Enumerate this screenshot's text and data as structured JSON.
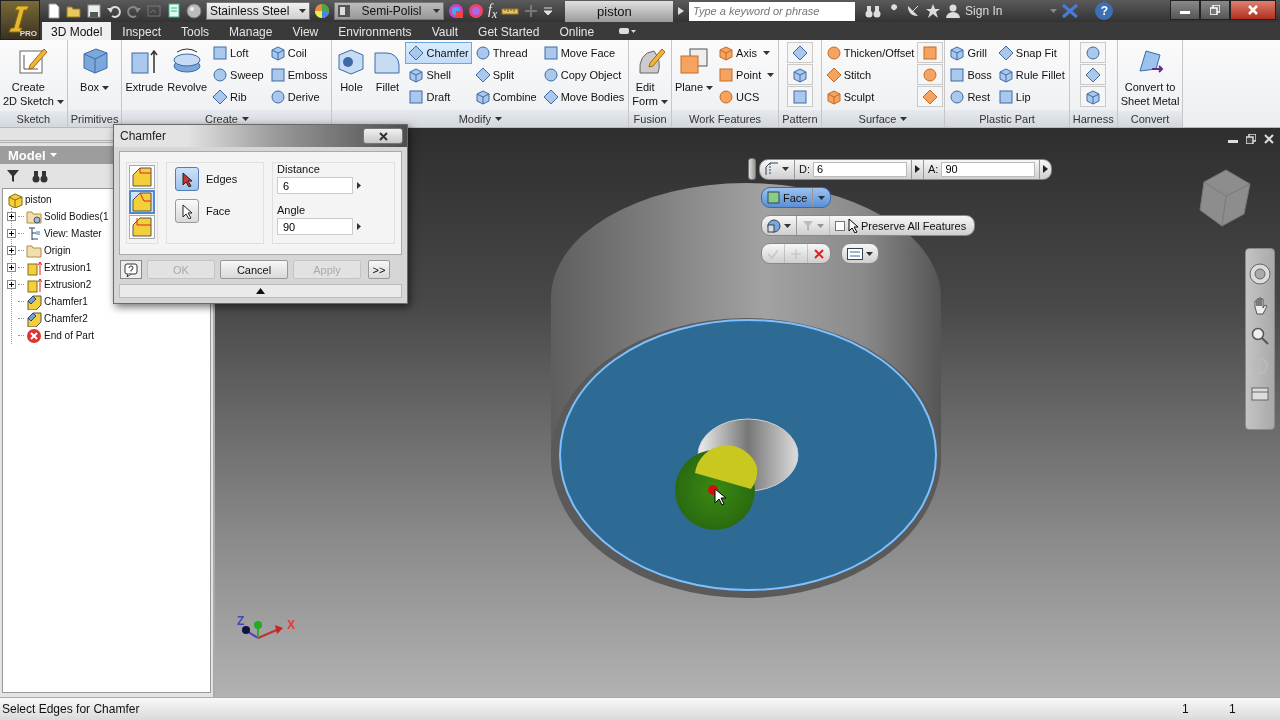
{
  "app": {
    "edition_badge": "PRO"
  },
  "quick_access": {
    "material": "Stainless Steel",
    "appearance": "Semi-Polisl",
    "parameters": "f$_{x}$"
  },
  "document_tab": {
    "title": "piston"
  },
  "search": {
    "placeholder": "Type a keyword or phrase"
  },
  "account": {
    "sign_in": "Sign In",
    "help": "?"
  },
  "tabs": [
    {
      "label": "3D Model",
      "selected": true
    },
    {
      "label": "Inspect",
      "selected": false
    },
    {
      "label": "Tools",
      "selected": false
    },
    {
      "label": "Manage",
      "selected": false
    },
    {
      "label": "View",
      "selected": false
    },
    {
      "label": "Environments",
      "selected": false
    },
    {
      "label": "Vault",
      "selected": false
    },
    {
      "label": "Get Started",
      "selected": false
    },
    {
      "label": "Online",
      "selected": false
    }
  ],
  "ribbon": {
    "panels": [
      {
        "title": "Sketch",
        "has_menu": false,
        "tools": [
          {
            "kind": "large",
            "label": "Create\n2D Sketch",
            "has_menu": true,
            "selected": false
          }
        ]
      },
      {
        "title": "Primitives",
        "has_menu": false,
        "tools": [
          {
            "kind": "large",
            "label": "Box",
            "has_menu": true,
            "selected": false
          }
        ]
      },
      {
        "title": "Create",
        "has_menu": true,
        "tools": [
          {
            "kind": "large",
            "label": "Extrude",
            "has_menu": false,
            "selected": false
          },
          {
            "kind": "large",
            "label": "Revolve",
            "has_menu": false,
            "selected": false
          },
          {
            "kind": "small",
            "label": "Loft",
            "has_menu": false,
            "selected": false
          },
          {
            "kind": "small",
            "label": "Sweep",
            "has_menu": false,
            "selected": false
          },
          {
            "kind": "small",
            "label": "Rib",
            "has_menu": false,
            "selected": false
          },
          {
            "kind": "small",
            "label": "Coil",
            "has_menu": false,
            "selected": false
          },
          {
            "kind": "small",
            "label": "Emboss",
            "has_menu": false,
            "selected": false
          },
          {
            "kind": "small",
            "label": "Derive",
            "has_menu": false,
            "selected": false
          }
        ]
      },
      {
        "title": "Modify",
        "has_menu": true,
        "tools": [
          {
            "kind": "large",
            "label": "Hole",
            "has_menu": false,
            "selected": false
          },
          {
            "kind": "large",
            "label": "Fillet",
            "has_menu": false,
            "selected": false
          },
          {
            "kind": "small",
            "label": "Chamfer",
            "has_menu": false,
            "selected": true
          },
          {
            "kind": "small",
            "label": "Shell",
            "has_menu": false,
            "selected": false
          },
          {
            "kind": "small",
            "label": "Draft",
            "has_menu": false,
            "selected": false
          },
          {
            "kind": "small",
            "label": "Thread",
            "has_menu": false,
            "selected": false
          },
          {
            "kind": "small",
            "label": "Split",
            "has_menu": false,
            "selected": false
          },
          {
            "kind": "small",
            "label": "Combine",
            "has_menu": false,
            "selected": false
          },
          {
            "kind": "small",
            "label": "Move Face",
            "has_menu": false,
            "selected": false
          },
          {
            "kind": "small",
            "label": "Copy Object",
            "has_menu": false,
            "selected": false
          },
          {
            "kind": "small",
            "label": "Move Bodies",
            "has_menu": false,
            "selected": false
          }
        ]
      },
      {
        "title": "Fusion",
        "has_menu": false,
        "tools": [
          {
            "kind": "large",
            "label": "Edit\nForm",
            "has_menu": true,
            "selected": false
          }
        ]
      },
      {
        "title": "Work Features",
        "has_menu": false,
        "tools": [
          {
            "kind": "large",
            "label": "Plane",
            "has_menu": true,
            "selected": false
          },
          {
            "kind": "small",
            "label": "Axis",
            "has_menu": true,
            "selected": false
          },
          {
            "kind": "small",
            "label": "Point",
            "has_menu": true,
            "selected": false
          },
          {
            "kind": "small",
            "label": "UCS",
            "has_menu": false,
            "selected": false
          }
        ]
      },
      {
        "title": "Pattern",
        "has_menu": false,
        "tools": [
          {
            "kind": "icon",
            "has_menu": false,
            "selected": false
          },
          {
            "kind": "icon",
            "has_menu": false,
            "selected": false
          },
          {
            "kind": "icon",
            "has_menu": false,
            "selected": false
          }
        ]
      },
      {
        "title": "Surface",
        "has_menu": true,
        "tools": [
          {
            "kind": "small",
            "label": "Thicken/Offset",
            "has_menu": false,
            "selected": false
          },
          {
            "kind": "small",
            "label": "Stitch",
            "has_menu": false,
            "selected": false
          },
          {
            "kind": "small",
            "label": "Sculpt",
            "has_menu": false,
            "selected": false
          },
          {
            "kind": "icon",
            "has_menu": false,
            "selected": false
          },
          {
            "kind": "icon",
            "has_menu": false,
            "selected": false
          },
          {
            "kind": "icon",
            "has_menu": false,
            "selected": false
          }
        ]
      },
      {
        "title": "Plastic Part",
        "has_menu": false,
        "tools": [
          {
            "kind": "small",
            "label": "Grill",
            "has_menu": false,
            "selected": false
          },
          {
            "kind": "small",
            "label": "Boss",
            "has_menu": false,
            "selected": false
          },
          {
            "kind": "small",
            "label": "Rest",
            "has_menu": false,
            "selected": false
          },
          {
            "kind": "small",
            "label": "Snap Fit",
            "has_menu": false,
            "selected": false
          },
          {
            "kind": "small",
            "label": "Rule Fillet",
            "has_menu": false,
            "selected": false
          },
          {
            "kind": "small",
            "label": "Lip",
            "has_menu": false,
            "selected": false
          }
        ]
      },
      {
        "title": "Harness",
        "has_menu": false,
        "tools": [
          {
            "kind": "icon",
            "has_menu": false,
            "selected": false
          },
          {
            "kind": "icon",
            "has_menu": false,
            "selected": false
          },
          {
            "kind": "icon",
            "has_menu": false,
            "selected": false
          }
        ]
      },
      {
        "title": "Convert",
        "has_menu": false,
        "tools": [
          {
            "kind": "large",
            "label": "Convert to\nSheet Metal",
            "has_menu": false,
            "selected": false
          }
        ]
      }
    ]
  },
  "browser": {
    "title": "Model",
    "tree": [
      {
        "label": "piston",
        "kind": "part",
        "children": [
          {
            "label": "Solid Bodies(1",
            "kind": "bodies",
            "expanded": false
          },
          {
            "label": "View: Master",
            "kind": "view",
            "expanded": false
          },
          {
            "label": "Origin",
            "kind": "folder",
            "expanded": false
          },
          {
            "label": "Extrusion1",
            "kind": "extrusion",
            "expanded": false
          },
          {
            "label": "Extrusion2",
            "kind": "extrusion",
            "expanded": false
          },
          {
            "label": "Chamfer1",
            "kind": "chamfer"
          },
          {
            "label": "Chamfer2",
            "kind": "chamfer"
          },
          {
            "label": "End of Part",
            "kind": "end"
          }
        ]
      }
    ]
  },
  "dialog": {
    "title": "Chamfer",
    "methods": [
      {
        "selected": false
      },
      {
        "selected": true
      },
      {
        "selected": false
      }
    ],
    "select_modes": [
      {
        "label": "Edges",
        "selected": true
      },
      {
        "label": "Face",
        "selected": false
      }
    ],
    "fields": [
      {
        "label": "Distance",
        "value": "6"
      },
      {
        "label": "Angle",
        "value": "90"
      }
    ],
    "buttons": [
      {
        "kind": "help",
        "disabled": false
      },
      {
        "kind": "text",
        "label": "OK",
        "disabled": true
      },
      {
        "kind": "text",
        "label": "Cancel",
        "disabled": false
      },
      {
        "kind": "text",
        "label": "Apply",
        "disabled": true
      },
      {
        "kind": "text",
        "label": ">>",
        "disabled": false
      }
    ]
  },
  "mini_toolbar": {
    "fields": [
      {
        "label": "D:",
        "value": "6"
      },
      {
        "label": "A:",
        "value": "90"
      }
    ],
    "select_button": {
      "label": "Face",
      "selected": true
    },
    "preserve": {
      "label": "Preserve All Features",
      "checked": false
    },
    "actions": [
      {
        "kind": "ok",
        "disabled": true
      },
      {
        "kind": "add",
        "disabled": true
      },
      {
        "kind": "cancel",
        "disabled": false
      }
    ]
  },
  "triad": {
    "labels": [
      "Z",
      "X"
    ]
  },
  "status_bar": {
    "message": "Select Edges for Chamfer",
    "counters": [
      "1",
      "1"
    ]
  }
}
